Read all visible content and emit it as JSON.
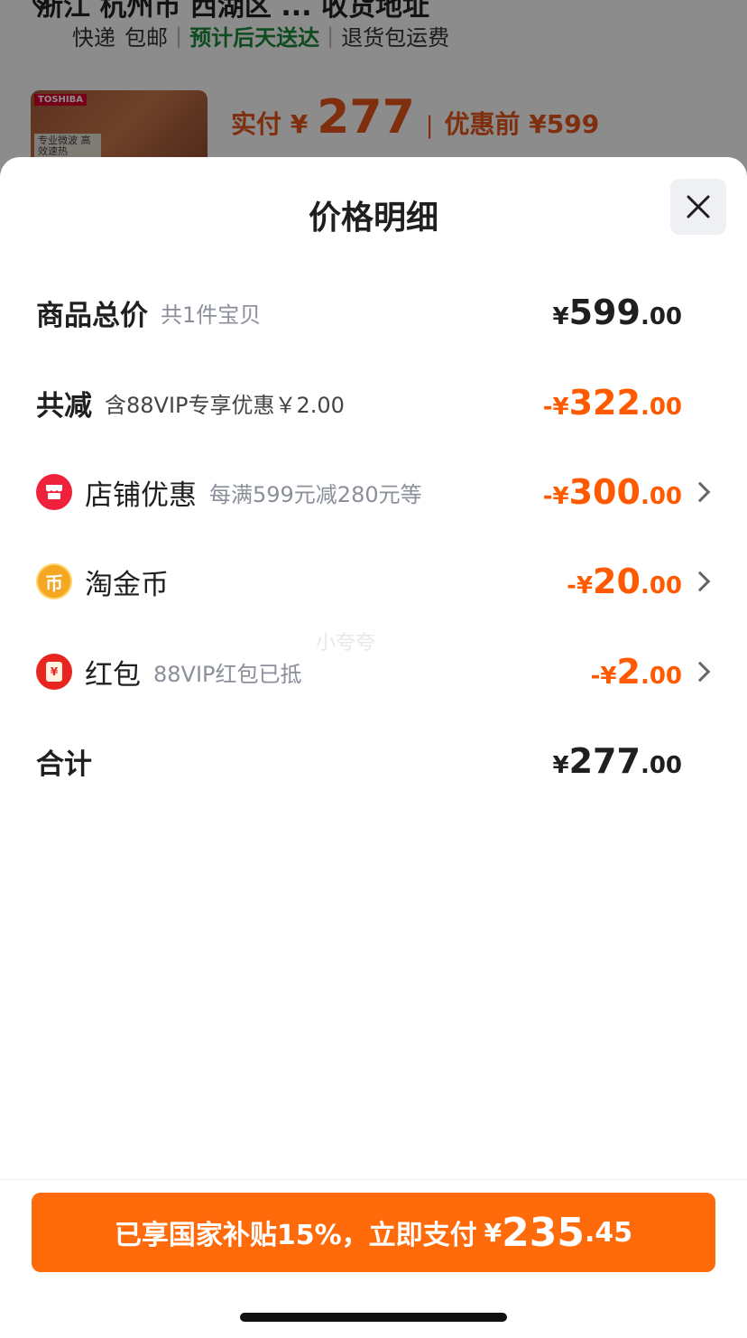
{
  "background": {
    "route_text": "浙江 杭州市 西湖区 ... 收货地址",
    "delivery": {
      "method": "快递",
      "shipping": "包邮",
      "estimate": "预计后天送达",
      "returns": "退货包运费"
    },
    "product": {
      "brand": "TOSHIBA",
      "tag": "专业微波 高效速热",
      "paid_label": "实付 ¥",
      "paid_amount": "277",
      "before_label": "优惠前 ¥599"
    }
  },
  "sheet": {
    "title": "价格明细",
    "rows": [
      {
        "label": "商品总价",
        "sub": "共1件宝贝",
        "currency": "¥",
        "integer": "599",
        "decimal": ".00"
      },
      {
        "label": "共减",
        "sub": "含88VIP专享优惠￥2.00",
        "currency": "-¥",
        "integer": "322",
        "decimal": ".00"
      },
      {
        "label": "店铺优惠",
        "sub": "每满599元减280元等",
        "currency": "-¥",
        "integer": "300",
        "decimal": ".00"
      },
      {
        "label": "淘金币",
        "sub": "",
        "currency": "-¥",
        "integer": "20",
        "decimal": ".00"
      },
      {
        "label": "红包",
        "sub": "88VIP红包已抵",
        "currency": "-¥",
        "integer": "2",
        "decimal": ".00"
      },
      {
        "label": "合计",
        "sub": "",
        "currency": "¥",
        "integer": "277",
        "decimal": ".00"
      }
    ],
    "icons": {
      "store": "store-icon",
      "coin": "coin-icon",
      "coin_glyph": "币",
      "redpacket": "red-packet-icon",
      "redpacket_glyph": "¥"
    },
    "watermark": "小夸夸"
  },
  "pay_button": {
    "text": "已享国家补贴15%，立即支付",
    "currency": "¥",
    "integer": "235",
    "decimal": ".45"
  },
  "colors": {
    "accent": "#ff6a0a",
    "discount": "#ff5a00",
    "store_icon": "#f0213a",
    "coin_icon": "#f5a623",
    "redpacket_icon": "#e8251f"
  }
}
